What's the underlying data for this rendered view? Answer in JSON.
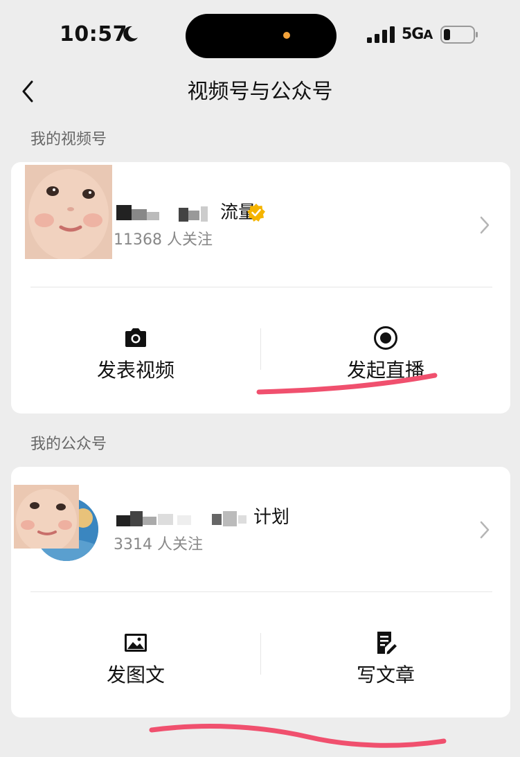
{
  "status_bar": {
    "time": "10:57",
    "network": "5G",
    "network_suffix": "A",
    "icons": [
      "moon-icon",
      "signal-icon",
      "battery-icon"
    ]
  },
  "nav": {
    "title": "视频号与公众号",
    "back_icon": "chevron-left-icon"
  },
  "channels": {
    "section_title": "我的视频号",
    "account": {
      "name_visible": "流量",
      "followers": "11368 人关注",
      "verified": true,
      "verified_color": "#f5b400"
    },
    "actions": [
      {
        "label": "发表视频",
        "icon": "camera-icon"
      },
      {
        "label": "发起直播",
        "icon": "live-record-icon"
      }
    ]
  },
  "official_account": {
    "section_title": "我的公众号",
    "account": {
      "name_visible": "计划",
      "followers": "3314 人关注"
    },
    "actions": [
      {
        "label": "发图文",
        "icon": "image-icon"
      },
      {
        "label": "写文章",
        "icon": "write-article-icon"
      }
    ]
  },
  "colors": {
    "background": "#ededed",
    "card": "#ffffff",
    "annotation_stroke": "#f0506e"
  }
}
